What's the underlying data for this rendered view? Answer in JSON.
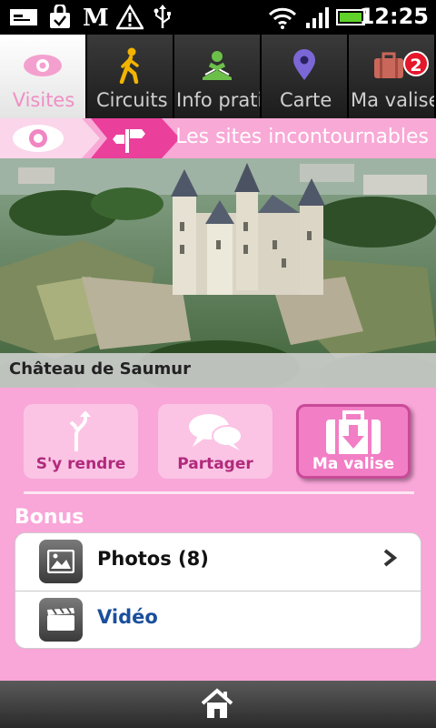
{
  "status_bar": {
    "time": "12:25",
    "icons": [
      "message-icon",
      "shopping-bag-icon",
      "le-monde-logo-icon",
      "warning-icon",
      "usb-icon",
      "wifi-icon",
      "signal-icon",
      "battery-icon"
    ]
  },
  "tabs": [
    {
      "label": "Visites",
      "icon": "eye-icon",
      "active": true
    },
    {
      "label": "Circuits",
      "icon": "walking-person-icon",
      "active": false
    },
    {
      "label": "Info pratiques",
      "icon": "info-reader-icon",
      "active": false
    },
    {
      "label": "Carte",
      "icon": "map-pin-icon",
      "active": false
    },
    {
      "label": "Ma valise",
      "icon": "suitcase-icon",
      "active": false,
      "badge": "2"
    }
  ],
  "section_header": {
    "title": "Les sites incontournables"
  },
  "hero": {
    "caption": "Château de Saumur"
  },
  "actions": [
    {
      "label": "S'y rendre",
      "icon": "directions-icon",
      "active": false
    },
    {
      "label": "Partager",
      "icon": "chat-bubbles-icon",
      "active": false
    },
    {
      "label": "Ma valise",
      "icon": "suitcase-add-icon",
      "active": true
    }
  ],
  "bonus": {
    "title": "Bonus",
    "items": [
      {
        "label": "Photos (8)",
        "icon": "photo-icon",
        "color": "#111111"
      },
      {
        "label": "Vidéo",
        "icon": "video-clapper-icon",
        "color": "#1a4f9c"
      }
    ]
  },
  "colors": {
    "accent_pink": "#f9a6d8",
    "active_pink": "#f27ec5",
    "label_pink": "#b02a7c"
  },
  "bottom_bar": {
    "icon": "home-icon"
  }
}
